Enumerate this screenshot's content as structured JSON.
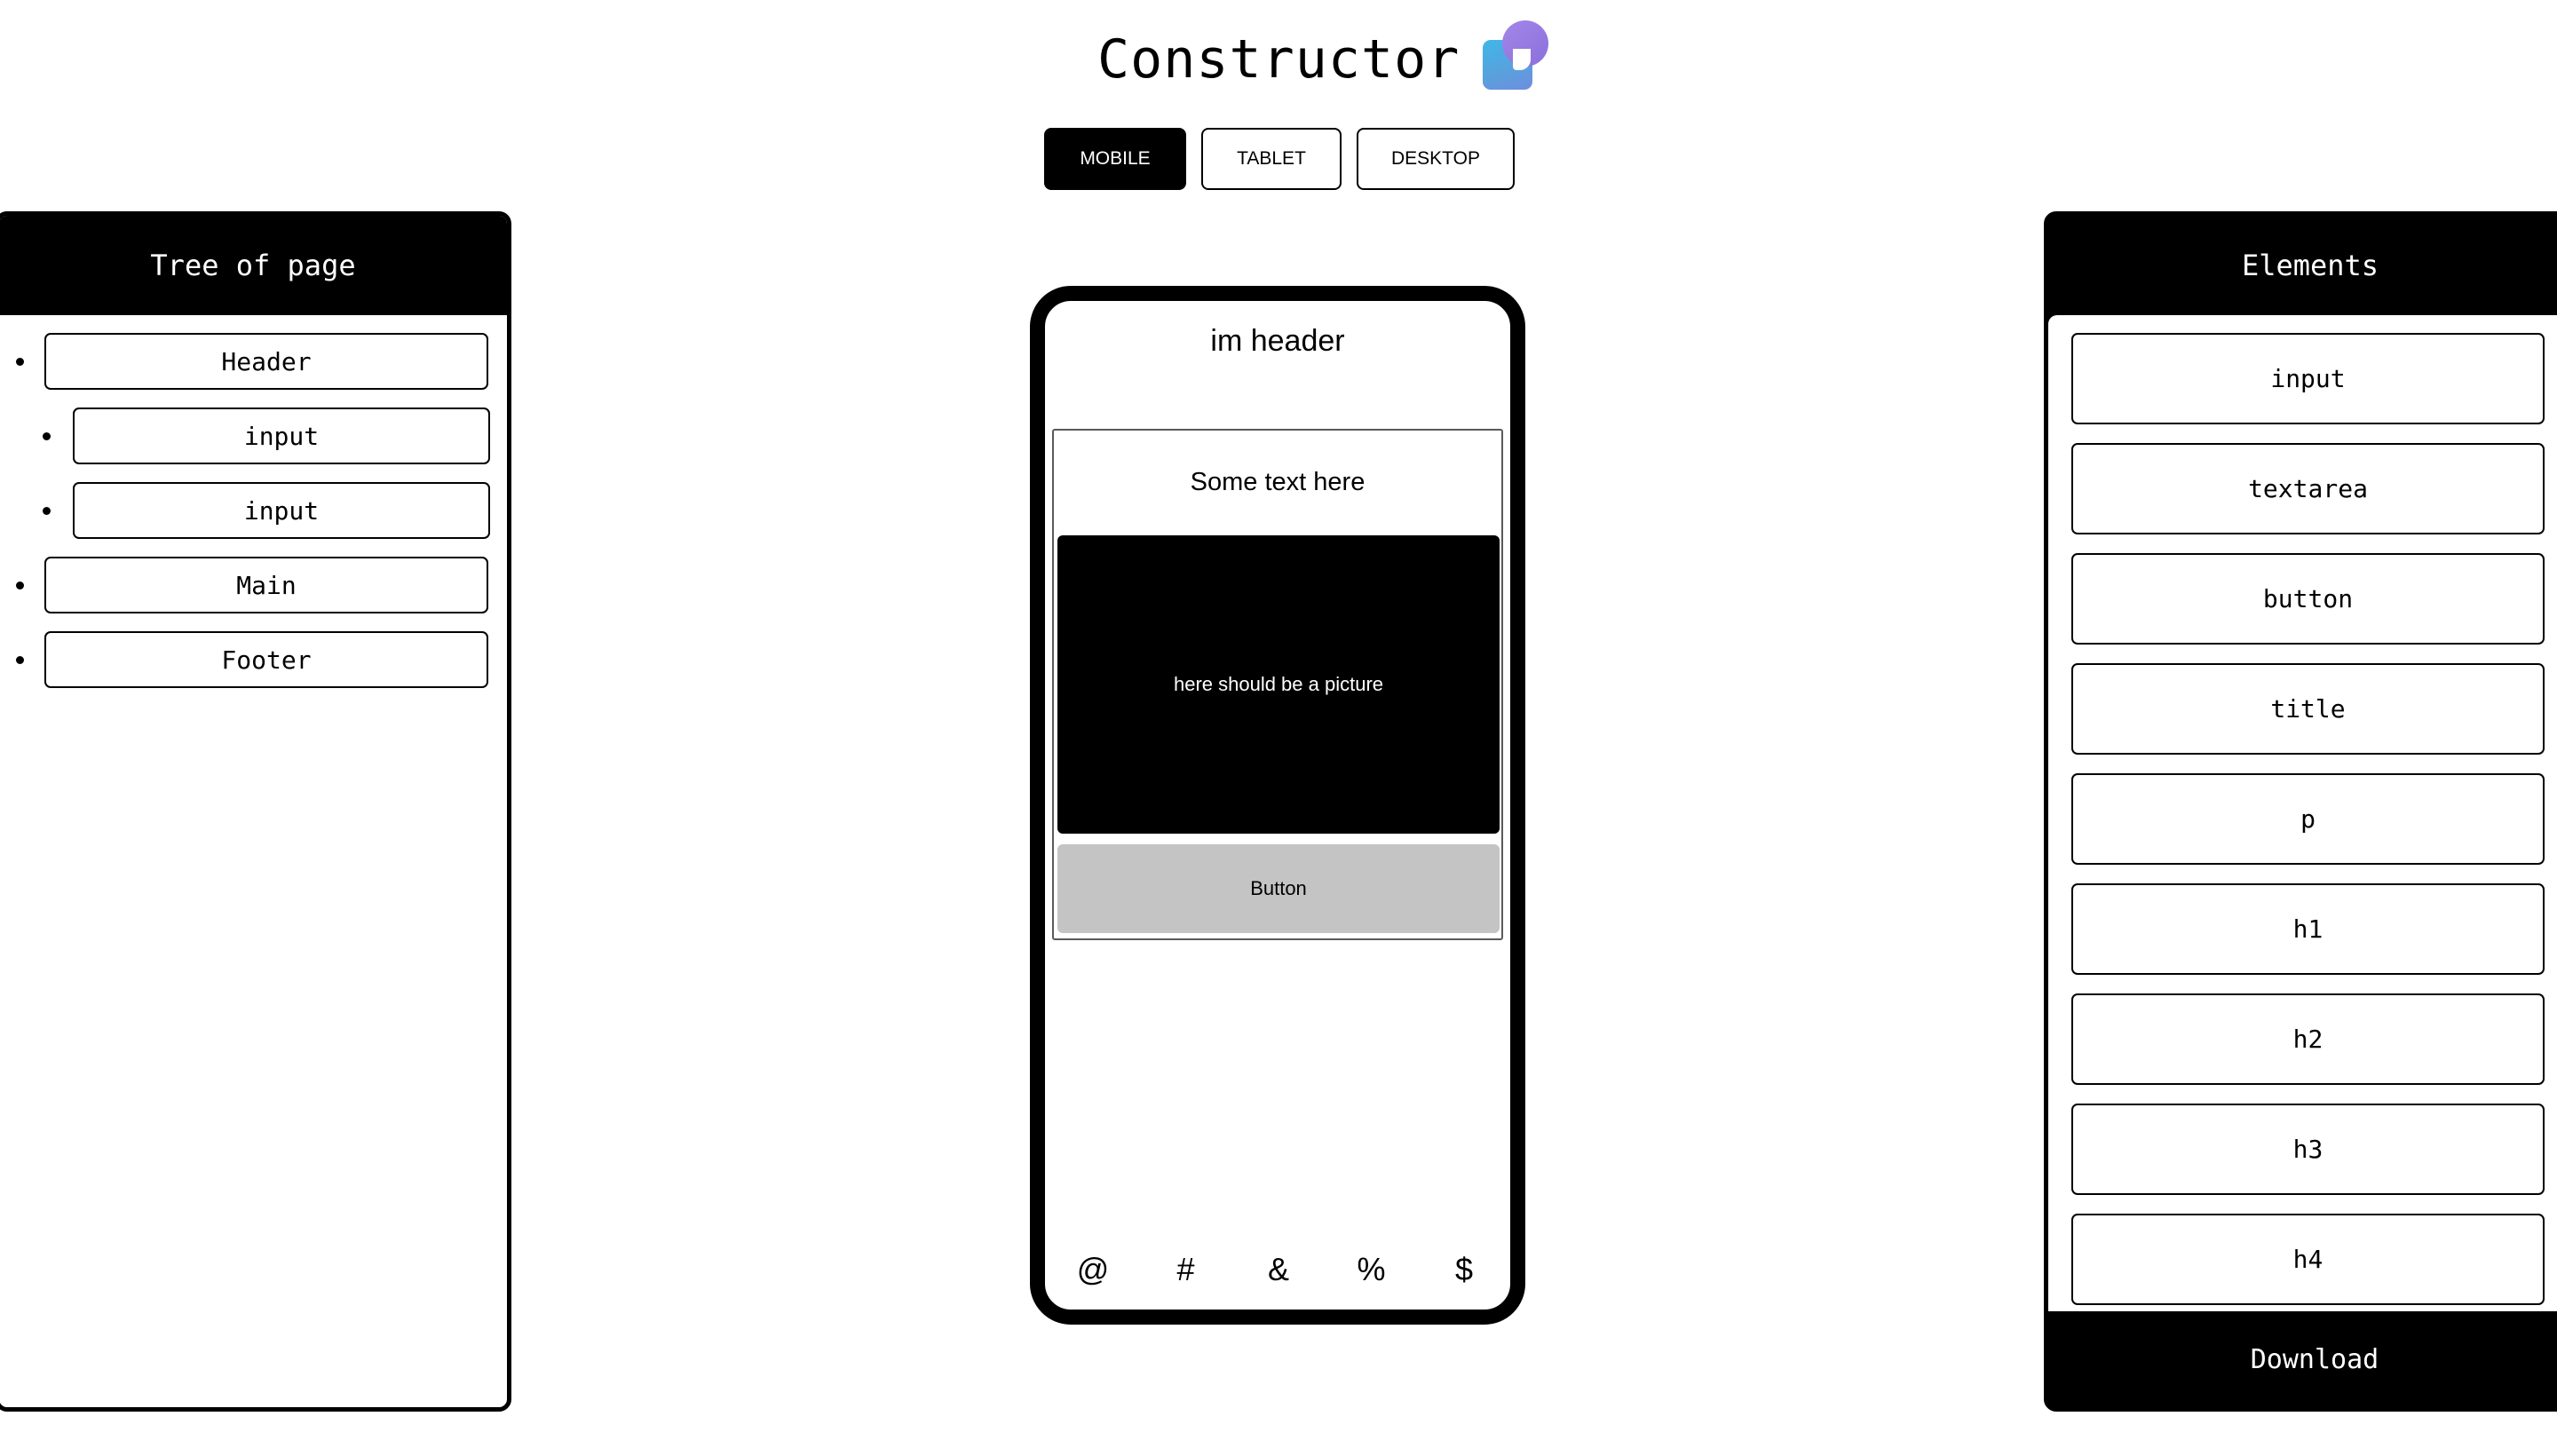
{
  "logo": {
    "text": "Constructor",
    "icon": "constructor-logo-icon"
  },
  "device_tabs": [
    {
      "label": "MOBILE",
      "active": true
    },
    {
      "label": "TABLET",
      "active": false
    },
    {
      "label": "DESKTOP",
      "active": false
    }
  ],
  "tree": {
    "title": "Tree of page",
    "items": [
      {
        "label": "Header",
        "level": 0
      },
      {
        "label": "input",
        "level": 1
      },
      {
        "label": "input",
        "level": 1
      },
      {
        "label": "Main",
        "level": 0
      },
      {
        "label": "Footer",
        "level": 0
      }
    ]
  },
  "preview": {
    "header_text": "im header",
    "main_text": "Some text here",
    "picture_text": "here should be a picture",
    "button_label": "Button",
    "footer_symbols": [
      "@",
      "#",
      "&",
      "%",
      "$"
    ]
  },
  "elements": {
    "title": "Elements",
    "items": [
      "input",
      "textarea",
      "button",
      "title",
      "p",
      "h1",
      "h2",
      "h3",
      "h4"
    ],
    "download_label": "Download"
  },
  "colors": {
    "dark": "#000000",
    "button_gray": "#c4c4c4",
    "logo_blue": "#4fa8e4",
    "logo_purple": "#9a7ee4"
  }
}
